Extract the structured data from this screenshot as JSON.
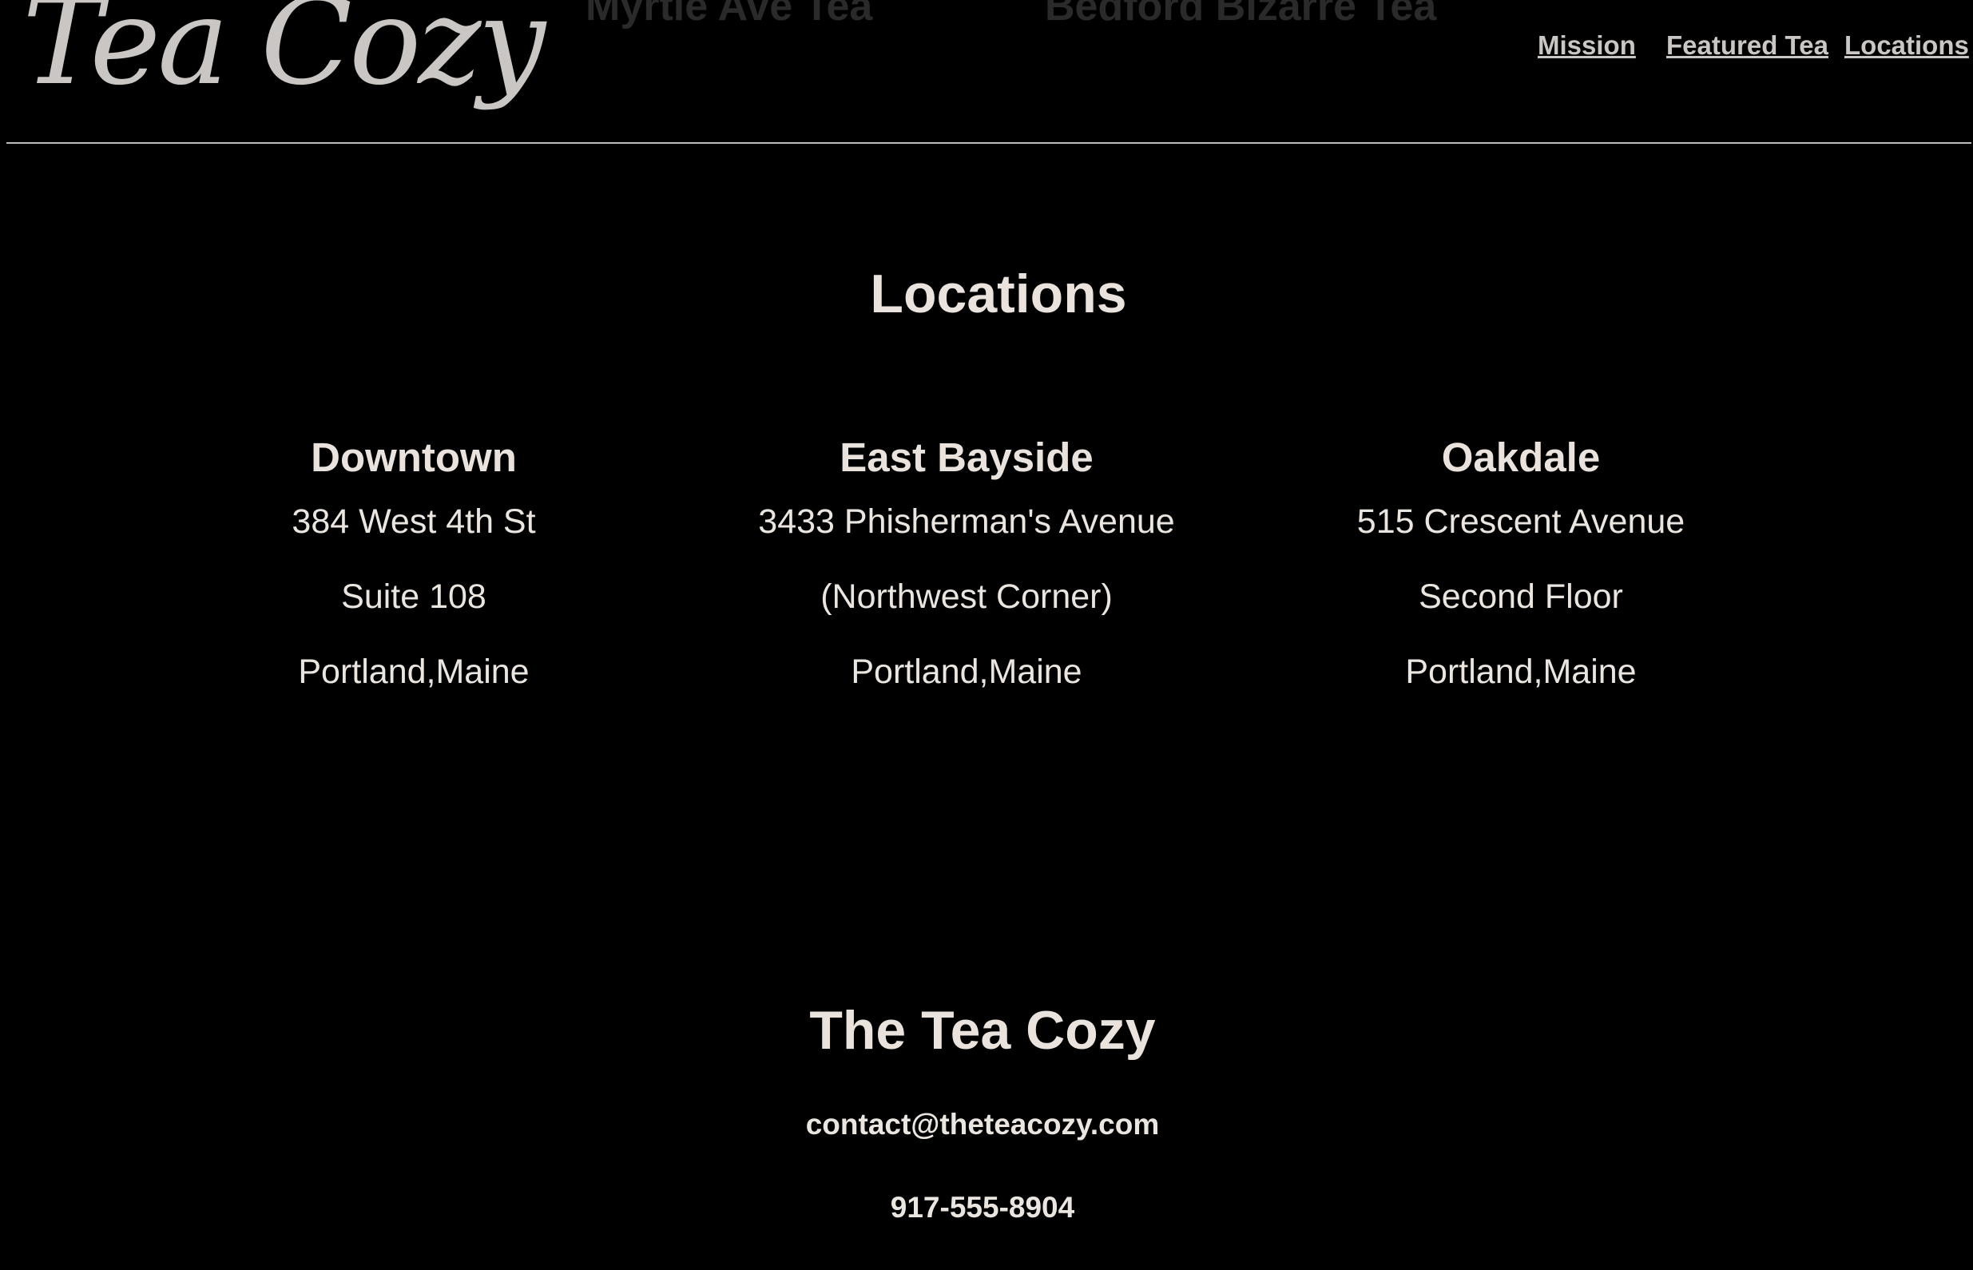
{
  "header": {
    "logo_text": "Tea Cozy",
    "ghost_links": [
      "Myrtle Ave Tea",
      "Bedford Bizarre Tea"
    ],
    "nav": {
      "mission": "Mission",
      "featured_tea": "Featured Tea",
      "locations": "Locations"
    }
  },
  "main": {
    "title": "Locations",
    "locations": [
      {
        "name": "Downtown",
        "lines": [
          "384 West 4th St",
          "Suite 108",
          "Portland,Maine"
        ]
      },
      {
        "name": "East Bayside",
        "lines": [
          "3433 Phisherman's Avenue",
          "(Northwest Corner)",
          "Portland,Maine"
        ]
      },
      {
        "name": "Oakdale",
        "lines": [
          "515 Crescent Avenue",
          "Second Floor",
          "Portland,Maine"
        ]
      }
    ]
  },
  "footer": {
    "title": "The Tea Cozy",
    "email": "contact@theteacozy.com",
    "phone": "917-555-8904"
  },
  "colors": {
    "background": "#000000",
    "text": "#e9e2dd",
    "nav_link": "#c9c6c3",
    "divider": "#bdbdbd"
  }
}
